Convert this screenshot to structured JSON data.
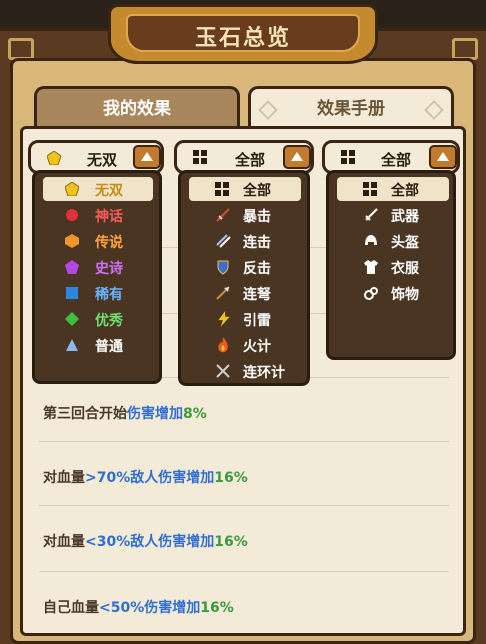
{
  "title": "玉石总览",
  "tabs": {
    "my_effects": "我的效果",
    "effect_manual": "效果手册"
  },
  "filters": {
    "rarity": {
      "selected": "无双",
      "options": [
        {
          "label": "无双",
          "color": "#f2c21b"
        },
        {
          "label": "神话",
          "color": "#e0323a"
        },
        {
          "label": "传说",
          "color": "#f0972a"
        },
        {
          "label": "史诗",
          "color": "#b546e8"
        },
        {
          "label": "稀有",
          "color": "#2f86e0"
        },
        {
          "label": "优秀",
          "color": "#3fbf3f"
        },
        {
          "label": "普通",
          "color": "#8fb7e8"
        }
      ]
    },
    "effect_type": {
      "selected": "全部",
      "options": [
        "全部",
        "暴击",
        "连击",
        "反击",
        "连弩",
        "引雷",
        "火计",
        "连环计"
      ]
    },
    "equip_slot": {
      "selected": "全部",
      "options": [
        "全部",
        "武器",
        "头盔",
        "衣服",
        "饰物"
      ]
    }
  },
  "effects": [
    {
      "prefix": "第三回合开始",
      "a": "伤害增加",
      "b": "8%"
    },
    {
      "prefix": "对血量",
      "a": ">70%敌人伤害增加",
      "b": "16%"
    },
    {
      "prefix": "对血量",
      "a": "<30%敌人伤害增加",
      "b": "16%"
    },
    {
      "prefix": "自己血量",
      "a": "<50%伤害增加",
      "b": "16%"
    }
  ]
}
